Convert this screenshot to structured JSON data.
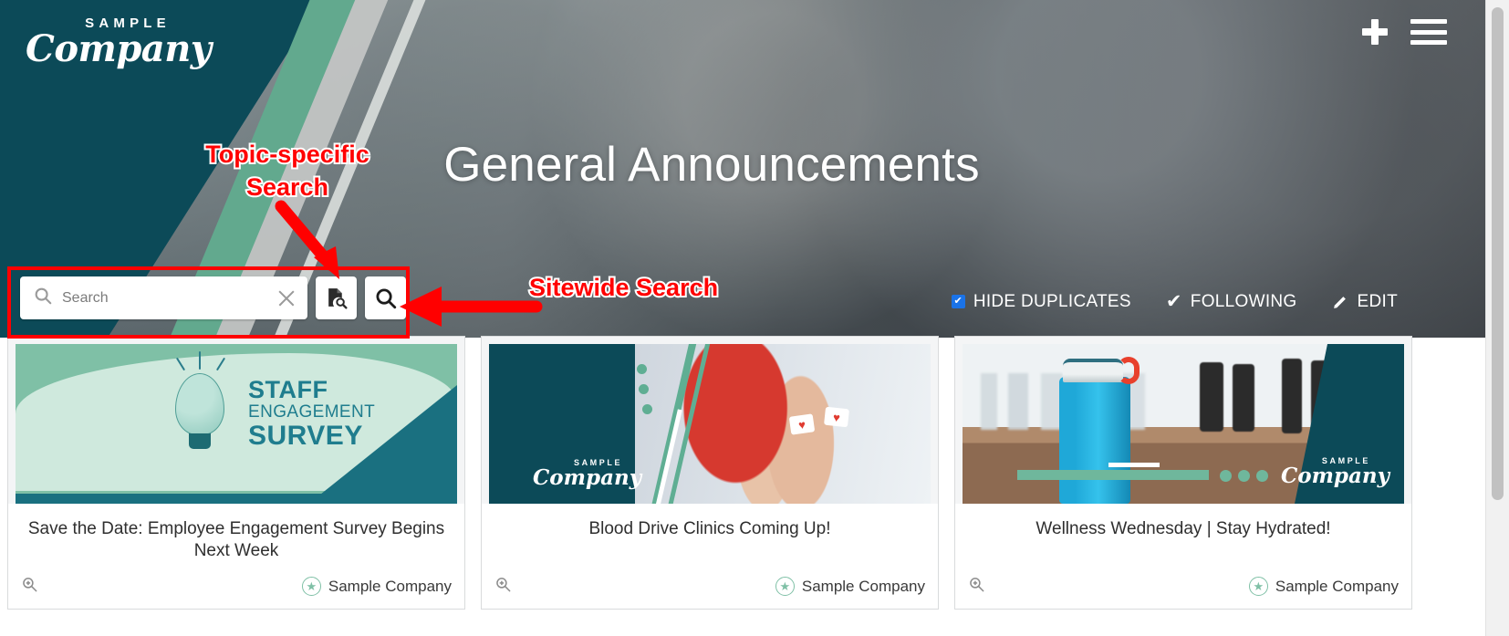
{
  "header": {
    "logo_top": "SAMPLE",
    "logo_main": "Company",
    "add_icon": "plus-icon",
    "menu_icon": "hamburger-menu-icon"
  },
  "hero": {
    "title": "General Announcements",
    "controls": {
      "hide_duplicates_label": "HIDE DUPLICATES",
      "hide_duplicates_checked": true,
      "following_label": "FOLLOWING",
      "following_check": "✔",
      "edit_label": "EDIT",
      "edit_icon": "pencil-icon"
    }
  },
  "search": {
    "placeholder": "Search",
    "value": "",
    "search_icon": "search-icon",
    "clear_icon": "close-icon",
    "topic_search_icon": "document-search-icon",
    "sitewide_search_icon": "search-icon"
  },
  "annotations": {
    "topic_search": "Topic-specific Search",
    "sitewide_search": "Sitewide Search",
    "color": "#ff0000",
    "outline_color": "#ffffff"
  },
  "colors": {
    "brand_teal": "#0c4a58",
    "brand_green": "#7fc0a6",
    "checkbox_blue": "#1a73e8",
    "star_green": "#7fc0a6"
  },
  "cards": [
    {
      "title": "Save the Date: Employee Engagement Survey Begins Next Week",
      "source": "Sample Company",
      "zoom_icon": "zoom-in-icon",
      "badge_icon": "star-icon",
      "art": {
        "line1": "STAFF",
        "line2": "ENGAGEMENT",
        "line3": "SURVEY"
      }
    },
    {
      "title": "Blood Drive Clinics Coming Up!",
      "source": "Sample Company",
      "zoom_icon": "zoom-in-icon",
      "badge_icon": "star-icon",
      "art": {
        "logo_top": "SAMPLE",
        "logo_main": "Company"
      }
    },
    {
      "title": "Wellness Wednesday | Stay Hydrated!",
      "source": "Sample Company",
      "zoom_icon": "zoom-in-icon",
      "badge_icon": "star-icon",
      "art": {
        "logo_top": "SAMPLE",
        "logo_main": "Company"
      }
    }
  ]
}
